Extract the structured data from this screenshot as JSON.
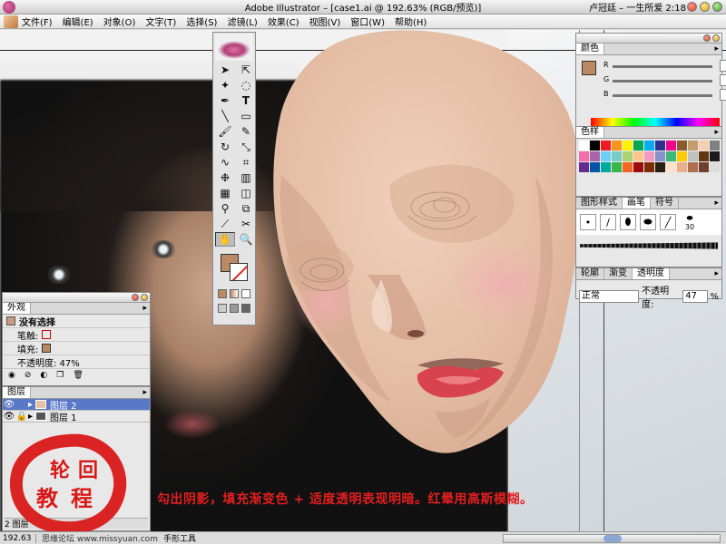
{
  "window": {
    "title": "Adobe Illustrator – [case1.ai @ 192.63% (RGB/预览)]",
    "right_text": "卢冠廷 – 一生所爱  2:18"
  },
  "menu": [
    "文件(F)",
    "编辑(E)",
    "对象(O)",
    "文字(T)",
    "选择(S)",
    "滤镜(L)",
    "效果(C)",
    "视图(V)",
    "窗口(W)",
    "帮助(H)"
  ],
  "color_palette": {
    "tab": "颜色",
    "sliders": [
      "R",
      "G",
      "B"
    ]
  },
  "swatch_palette": {
    "tab": "色样"
  },
  "brush_palette": {
    "tabs": [
      "图形样式",
      "画笔",
      "符号"
    ],
    "brush_size": "30"
  },
  "transparency_palette": {
    "tabs": [
      "轮廓",
      "渐变",
      "透明度"
    ],
    "mode": "正常",
    "opacity_label": "不透明度:",
    "opacity_value": "47",
    "opacity_unit": "%"
  },
  "appearance_palette": {
    "tab": "外观",
    "title": "没有选择",
    "stroke_label": "笔触:",
    "fill_label": "填充:",
    "opacity_text": "不透明度: 47%"
  },
  "layers_palette": {
    "tab": "图层",
    "layers": [
      {
        "name": "图层 2",
        "active": true
      },
      {
        "name": "图层 1",
        "active": false
      }
    ],
    "footer": "2 图层"
  },
  "caption": "勾出阴影，填充渐变色 + 适度透明表现明暗。红晕用高斯模糊。",
  "stamp": {
    "chars": [
      "轮",
      "回",
      "教",
      "程"
    ]
  },
  "status": {
    "zoom": "192.63",
    "tool": "手形工具",
    "watermark": "思缘论坛 www.missyuan.com"
  },
  "colors": {
    "accent_red": "#e31f1f",
    "skin": "#e8c1a8",
    "fill_swatch": "#b98a64"
  }
}
